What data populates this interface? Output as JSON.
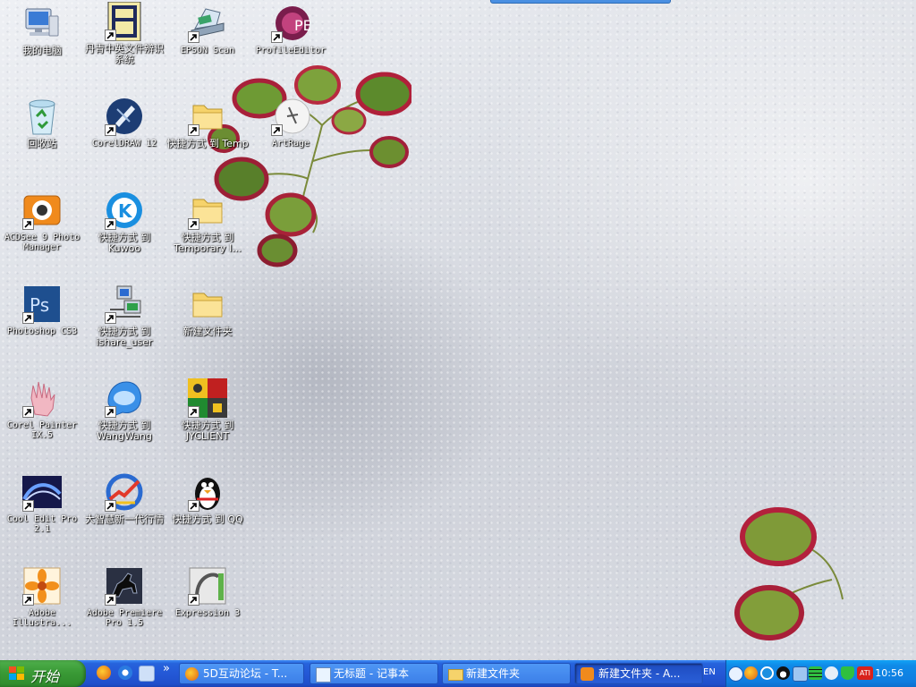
{
  "desktop": {
    "icons": [
      {
        "id": "my-computer",
        "label": "我的电脑",
        "cjk": true
      },
      {
        "id": "danqing",
        "label": "丹青中英文件辨识系统",
        "cjk": true
      },
      {
        "id": "epson-scan",
        "label": "EPSON Scan",
        "cjk": false
      },
      {
        "id": "profile-editor",
        "label": "ProfileEditor",
        "cjk": false
      },
      {
        "id": "recycle-bin",
        "label": "回收站",
        "cjk": true
      },
      {
        "id": "coreldraw",
        "label": "CorelDRAW 12",
        "cjk": false
      },
      {
        "id": "shortcut-temp",
        "label": "快捷方式 到 Temp",
        "cjk": true
      },
      {
        "id": "artrage",
        "label": "ArtRage",
        "cjk": false
      },
      {
        "id": "acdsee",
        "label": "ACDSee 9 Photo Manager",
        "cjk": false
      },
      {
        "id": "shortcut-kuwoo",
        "label": "快捷方式 到 Kuwoo",
        "cjk": true
      },
      {
        "id": "shortcut-temporary",
        "label": "快捷方式 到 Temporary I...",
        "cjk": true
      },
      {
        "id": "photoshop",
        "label": "Photoshop CS3",
        "cjk": false
      },
      {
        "id": "shortcut-ishare",
        "label": "快捷方式 到 ishare_user",
        "cjk": true
      },
      {
        "id": "new-folder",
        "label": "新建文件夹",
        "cjk": true
      },
      {
        "id": "corel-painter",
        "label": "Corel Painter IX.5",
        "cjk": false
      },
      {
        "id": "shortcut-wangwang",
        "label": "快捷方式 到 WangWang",
        "cjk": true
      },
      {
        "id": "shortcut-jyclient",
        "label": "快捷方式 到 JYCLIENT",
        "cjk": true
      },
      {
        "id": "cool-edit",
        "label": "Cool Edit Pro 2.1",
        "cjk": false
      },
      {
        "id": "dazhihui",
        "label": "大智慧新一代行情",
        "cjk": true
      },
      {
        "id": "shortcut-qq",
        "label": "快捷方式 到 QQ",
        "cjk": true
      },
      {
        "id": "illustrator",
        "label": "Adobe Illustra...",
        "cjk": false
      },
      {
        "id": "premiere",
        "label": "Adobe Premiere Pro 1.5",
        "cjk": false
      },
      {
        "id": "expression3",
        "label": "Expression 3",
        "cjk": false
      }
    ]
  },
  "taskbar": {
    "start_label": "开始",
    "quicklaunch": [
      "firefox-icon",
      "ie-icon",
      "show-desktop-icon"
    ],
    "overflow": "»",
    "tasks": [
      {
        "label": "5D互动论坛 - T...",
        "icon": "firefox-icon",
        "active": false
      },
      {
        "label": "无标题 - 记事本",
        "icon": "notepad-icon",
        "active": false
      },
      {
        "label": "新建文件夹",
        "icon": "folder-icon",
        "active": false
      },
      {
        "label": "新建文件夹 - A...",
        "icon": "acdsee-icon",
        "active": true
      }
    ],
    "tray": {
      "lang": "EN",
      "icons": [
        "back-arrow-icon",
        "firefox-tray-icon",
        "kuwoo-tray-icon",
        "qq-tray-icon",
        "network-icon",
        "meter-icon",
        "volume-icon",
        "shield-tray-icon",
        "ati-icon"
      ],
      "ati_text": "ATI",
      "time": "10:56"
    }
  },
  "colors": {
    "taskbar": "#2458d6",
    "start": "#3a9a36",
    "tray": "#0f8ae8"
  }
}
